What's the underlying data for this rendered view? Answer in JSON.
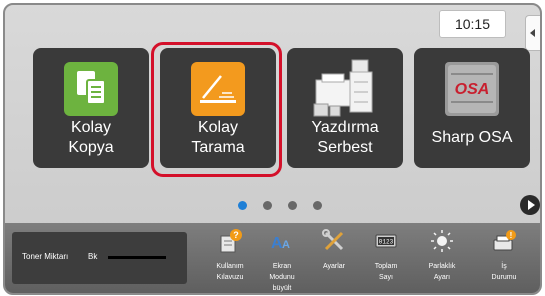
{
  "status_bar": {
    "time": "10:15"
  },
  "tiles": [
    {
      "label": "Kolay\nKopya",
      "icon": "copy-icon",
      "color": "#6db33f"
    },
    {
      "label": "Kolay\nTarama",
      "icon": "scan-icon",
      "color": "#f39a1e",
      "highlighted": true
    },
    {
      "label": "Yazdırma\nSerbest",
      "icon": "printer-icon"
    },
    {
      "label": "Sharp OSA",
      "icon": "osa-icon",
      "logo_text": "OSA"
    }
  ],
  "pagination": {
    "pages": 4,
    "current": 1
  },
  "bottom_bar": {
    "toner": {
      "label": "Toner Miktarı",
      "channel": "Bk"
    },
    "buttons": [
      {
        "label": "Kullanım\nKılavuzu",
        "icon": "manual-icon"
      },
      {
        "label": "Ekran\nModunu\nbüyült",
        "icon": "display-mode-icon"
      },
      {
        "label": "Ayarlar",
        "icon": "settings-icon"
      },
      {
        "label": "Toplam\nSayı",
        "icon": "counter-icon"
      },
      {
        "label": "Parlaklık\nAyarı",
        "icon": "brightness-icon"
      },
      {
        "label": "İş\nDurumu",
        "icon": "job-status-icon"
      }
    ]
  },
  "colors": {
    "highlight": "#d4102a",
    "active_dot": "#1e7fd6",
    "tile_bg": "#3a3a3a"
  }
}
